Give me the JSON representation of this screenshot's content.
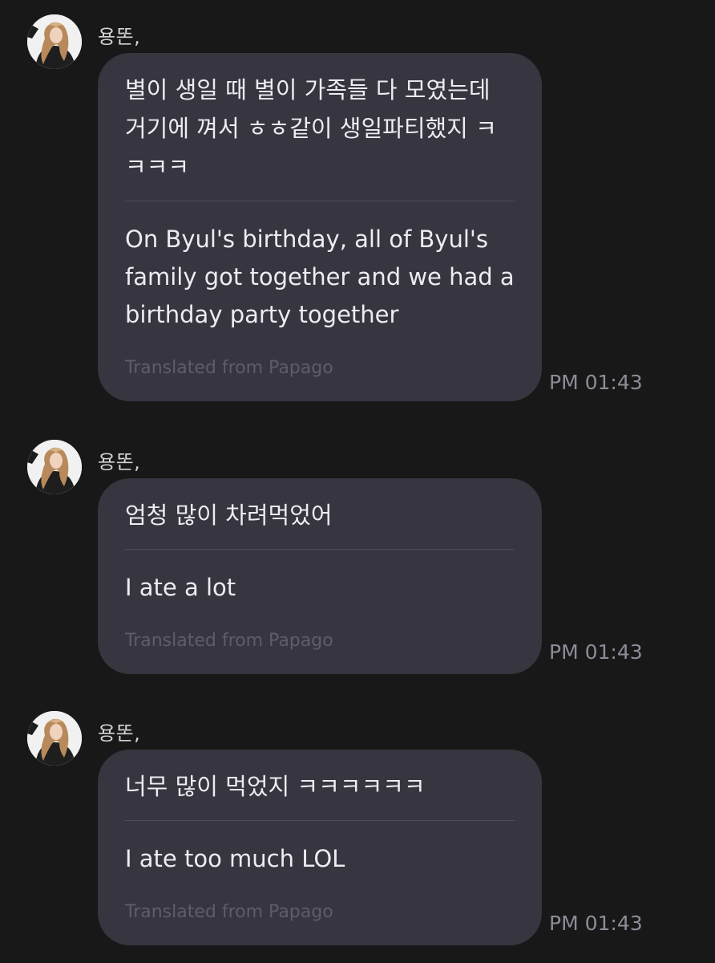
{
  "messages": [
    {
      "sender": "용똔,",
      "original": "별이 생일 때 별이 가족들 다 모였는데 거기에 껴서 ㅎㅎ같이 생일파티했지 ㅋㅋㅋㅋ",
      "translated": "On Byul's birthday, all of Byul's family got together and we had a birthday party together",
      "source": "Translated from Papago",
      "time": "PM 01:43"
    },
    {
      "sender": "용똔,",
      "original": "엄청 많이 차려먹었어",
      "translated": "I ate a lot",
      "source": "Translated from Papago",
      "time": "PM 01:43"
    },
    {
      "sender": "용똔,",
      "original": "너무 많이 먹었지 ㅋㅋㅋㅋㅋㅋ",
      "translated": "I ate too much LOL",
      "source": "Translated from Papago",
      "time": "PM 01:43"
    }
  ]
}
